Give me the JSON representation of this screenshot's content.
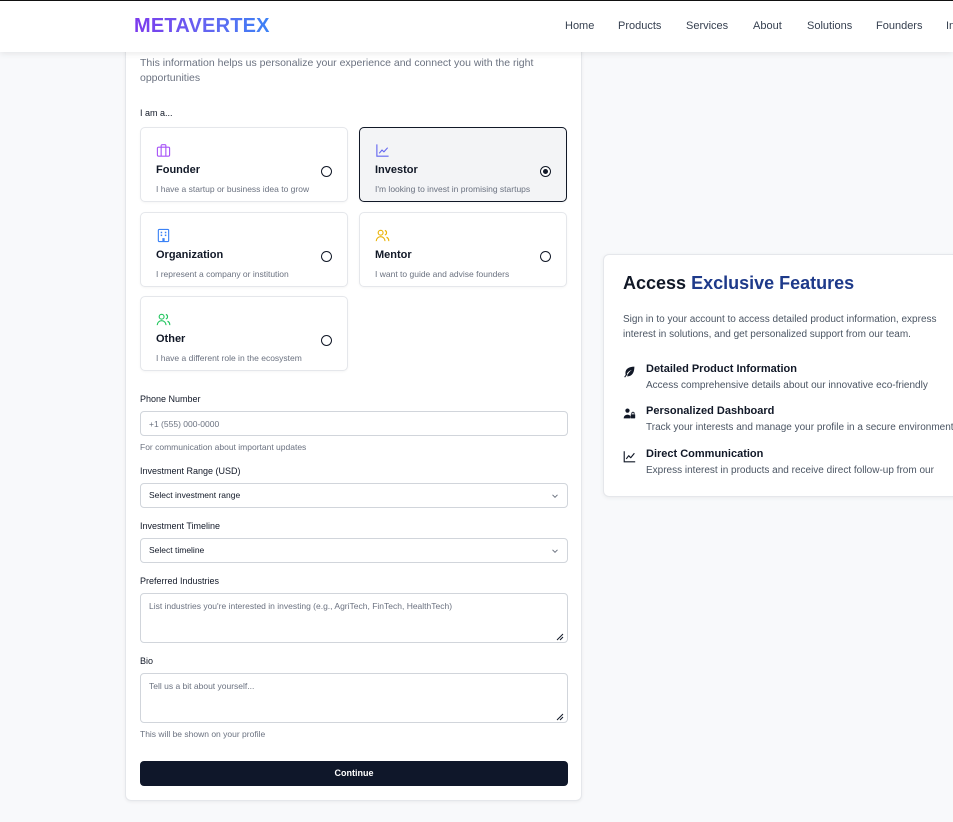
{
  "header": {
    "logo": "METAVERTEX",
    "nav": [
      "Home",
      "Products",
      "Services",
      "About",
      "Solutions",
      "Founders",
      "In"
    ]
  },
  "form": {
    "subtitle": "This information helps us personalize your experience and connect you with the right opportunities",
    "role_label": "I am a...",
    "roles": [
      {
        "title": "Founder",
        "desc": "I have a startup or business idea to grow",
        "icon": "briefcase-icon",
        "color": "#a855f7",
        "selected": false
      },
      {
        "title": "Investor",
        "desc": "I'm looking to invest in promising startups",
        "icon": "chart-line-icon",
        "color": "#6366f1",
        "selected": true
      },
      {
        "title": "Organization",
        "desc": "I represent a company or institution",
        "icon": "building-icon",
        "color": "#3b82f6",
        "selected": false
      },
      {
        "title": "Mentor",
        "desc": "I want to guide and advise founders",
        "icon": "users-icon",
        "color": "#eab308",
        "selected": false
      },
      {
        "title": "Other",
        "desc": "I have a different role in the ecosystem",
        "icon": "users-icon",
        "color": "#22c55e",
        "selected": false
      }
    ],
    "phone": {
      "label": "Phone Number",
      "placeholder": "+1 (555) 000-0000",
      "value": "",
      "help": "For communication about important updates"
    },
    "investment_range": {
      "label": "Investment Range (USD)",
      "selected": "Select investment range"
    },
    "investment_timeline": {
      "label": "Investment Timeline",
      "selected": "Select timeline"
    },
    "industries": {
      "label": "Preferred Industries",
      "placeholder": "List industries you're interested in investing (e.g., AgriTech, FinTech, HealthTech)",
      "value": ""
    },
    "bio": {
      "label": "Bio",
      "placeholder": "Tell us a bit about yourself...",
      "value": "",
      "help": "This will be shown on your profile"
    },
    "continue_label": "Continue"
  },
  "features": {
    "title_part1": "Access ",
    "title_part2": "Exclusive Features",
    "description": "Sign in to your account to access detailed product information, express interest in solutions, and get personalized support from our team.",
    "items": [
      {
        "title": "Detailed Product Information",
        "desc": "Access comprehensive details about our innovative eco-friendly",
        "icon": "leaf-icon"
      },
      {
        "title": "Personalized Dashboard",
        "desc": "Track your interests and manage your profile in a secure environment",
        "icon": "users-lock-icon"
      },
      {
        "title": "Direct Communication",
        "desc": "Express interest in products and receive direct follow-up from our",
        "icon": "chart-line-icon"
      }
    ]
  },
  "colors": {
    "primary": "#0f172a",
    "accent_blue": "#1e3a8a"
  }
}
